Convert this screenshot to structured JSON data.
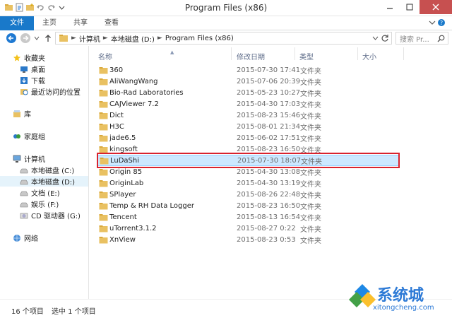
{
  "window": {
    "title": "Program Files (x86)"
  },
  "ribbon": {
    "tabs": [
      "文件",
      "主页",
      "共享",
      "查看"
    ]
  },
  "address": {
    "crumbs": [
      "计算机",
      "本地磁盘 (D:)",
      "Program Files (x86)"
    ],
    "search_placeholder": "搜索 Pr..."
  },
  "nav": {
    "favorites": "收藏夹",
    "fav_items": [
      "桌面",
      "下载",
      "最近访问的位置"
    ],
    "libraries": "库",
    "homegroup": "家庭组",
    "computer": "计算机",
    "drives": [
      "本地磁盘 (C:)",
      "本地磁盘 (D:)",
      "文档 (E:)",
      "娱乐 (F:)",
      "CD 驱动器 (G:)"
    ],
    "network": "网络"
  },
  "columns": {
    "name": "名称",
    "date": "修改日期",
    "type": "类型",
    "size": "大小"
  },
  "files": [
    {
      "name": "360",
      "date": "2015-07-30 17:41",
      "type": "文件夹"
    },
    {
      "name": "AliWangWang",
      "date": "2015-07-06 20:39",
      "type": "文件夹"
    },
    {
      "name": "Bio-Rad Laboratories",
      "date": "2015-05-23 10:27",
      "type": "文件夹"
    },
    {
      "name": "CAJViewer 7.2",
      "date": "2015-04-30 17:03",
      "type": "文件夹"
    },
    {
      "name": "Dict",
      "date": "2015-08-23 15:46",
      "type": "文件夹"
    },
    {
      "name": "H3C",
      "date": "2015-08-01 21:34",
      "type": "文件夹"
    },
    {
      "name": "jade6.5",
      "date": "2015-06-02 17:51",
      "type": "文件夹"
    },
    {
      "name": "kingsoft",
      "date": "2015-08-23 16:50",
      "type": "文件夹"
    },
    {
      "name": "LuDaShi",
      "date": "2015-07-30 18:07",
      "type": "文件夹"
    },
    {
      "name": "Origin 85",
      "date": "2015-04-30 13:08",
      "type": "文件夹"
    },
    {
      "name": "OriginLab",
      "date": "2015-04-30 13:19",
      "type": "文件夹"
    },
    {
      "name": "SPlayer",
      "date": "2015-08-26 22:48",
      "type": "文件夹"
    },
    {
      "name": "Temp & RH Data Logger",
      "date": "2015-08-23 16:50",
      "type": "文件夹"
    },
    {
      "name": "Tencent",
      "date": "2015-08-13 16:54",
      "type": "文件夹"
    },
    {
      "name": "uTorrent3.1.2",
      "date": "2015-08-27 0:22",
      "type": "文件夹"
    },
    {
      "name": "XnView",
      "date": "2015-08-23 0:53",
      "type": "文件夹"
    }
  ],
  "selected_index": 8,
  "status": {
    "count": "16 个项目",
    "selected": "选中 1 个项目"
  },
  "watermark": {
    "brand": "系统城",
    "url": "xitongcheng.com"
  },
  "colors": {
    "accent": "#1979ca",
    "selection": "#cce8ff",
    "highlight_box": "#d9232e",
    "folder": "#e9c162"
  }
}
